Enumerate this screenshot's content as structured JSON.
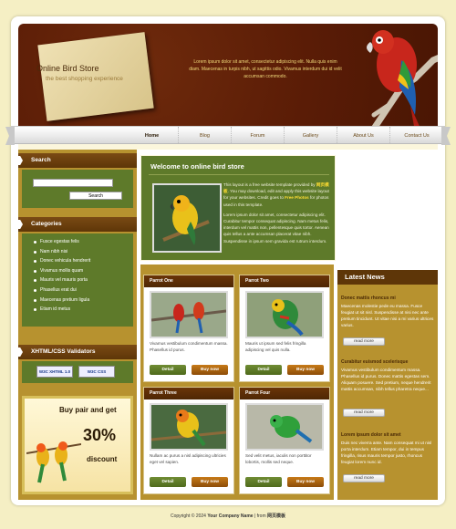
{
  "header": {
    "store_title": "Online Bird Store",
    "store_subtitle": "the best shopping experience",
    "blurb": "Lorem ipsum dolor sit amet, consectetur adipiscing elit. Nulla quis enim diam. Maecenas in turpis nibh, ut sagittis odio. Vivamus interdum dui id velit accumsan commodo."
  },
  "nav": {
    "items": [
      {
        "label": "Home"
      },
      {
        "label": "Blog"
      },
      {
        "label": "Forum"
      },
      {
        "label": "Gallery"
      },
      {
        "label": "About Us"
      },
      {
        "label": "Contact Us"
      }
    ]
  },
  "sidebar": {
    "search_title": "Search",
    "search_button": "Search",
    "categories_title": "Categories",
    "categories": [
      "Fusce egestas felis",
      "Nam nibh nisi",
      "Donec vehicula hendrerit",
      "Vivamus mollis quam",
      "Mauris vel mauris porta",
      "Phasellus erat dui",
      "Maecenas pretium ligula",
      "Etiam id metus"
    ],
    "validators_title": "XHTML/CSS Validators",
    "badge_xhtml": "W3C XHTML 1.0",
    "badge_css": "W3C CSS",
    "promo": {
      "line1": "Buy pair and  get",
      "line2": "30%",
      "line3": "discount"
    }
  },
  "welcome": {
    "title": "Welcome to online bird store",
    "text_before": "This layout is a free website template provided by ",
    "text_link": "网页模板",
    "text_mid": ". You may download, edit and apply this website layout for your websites. Credit goes to ",
    "text_link2": "Free Photos",
    "text_after": " for photos used in this template.",
    "paragraph2": "Lorem ipsum dolor sit amet, consectetur adipiscing elit. Curabitur tempor consequat adipiscing. Nam metus felis, interdum vel mattis non, pellentesque quis tortor. Aenean quis tellus a ante accumsan placerat vitae nibh. Suspendisse in ipsum sem gravida est rutrum interdum."
  },
  "products": [
    {
      "name": "Parrot One",
      "desc": "Vivamus vestibulum condimentum massa. Phasellus id purus.",
      "detail": "Detail",
      "buy": "Buy now"
    },
    {
      "name": "Parrot Two",
      "desc": "Mauris ut ipsum sed felis fringilla adipiscing vel quis nulla.",
      "detail": "Detail",
      "buy": "Buy now"
    },
    {
      "name": "Parrot Three",
      "desc": "Nullam ac purus a nisl adipiscing ultricies eget vel sapien.",
      "detail": "Detail",
      "buy": "Buy now"
    },
    {
      "name": "Parrot Four",
      "desc": "Sed velit metus, iaculis non porttitor lobortis, mollis sed neque.",
      "detail": "Detail",
      "buy": "Buy now"
    }
  ],
  "news": {
    "title": "Latest News",
    "items": [
      {
        "title": "Donec mattis rhoncus mi",
        "body": "Maecenas molestie pede eu massa. Fusce feugiat ut sit nisl. Suspendisse at nisi nec ante pretium tincidunt. Ut vitae nisi a mi varius ultrices varius.",
        "more": "read more"
      },
      {
        "title": "Curabitur euismod scelerisque",
        "body": "Vivamus vestibulum condimentum massa. Phasellus id purus. Donec mattis egestas sem. Aliquam posuere. Sed pretium, neque hendrerit mattis accumsan, nibh tellus pharetra neque...",
        "more": "read more"
      },
      {
        "title": "Lorem ipsum dolor sit amet",
        "body": "Duis nec viverra ante. Nam consequat mi ut nisl porta interdum. Etiam tempor, dui in tempus fringilla, risus mauris tempor justo, rhoncus feugiat lorem nunc id.",
        "more": "read more"
      }
    ]
  },
  "footer": {
    "prefix": "Copyright © 2024 ",
    "company": "Your Company Name",
    "suffix": " | from ",
    "source": "网页模板"
  }
}
